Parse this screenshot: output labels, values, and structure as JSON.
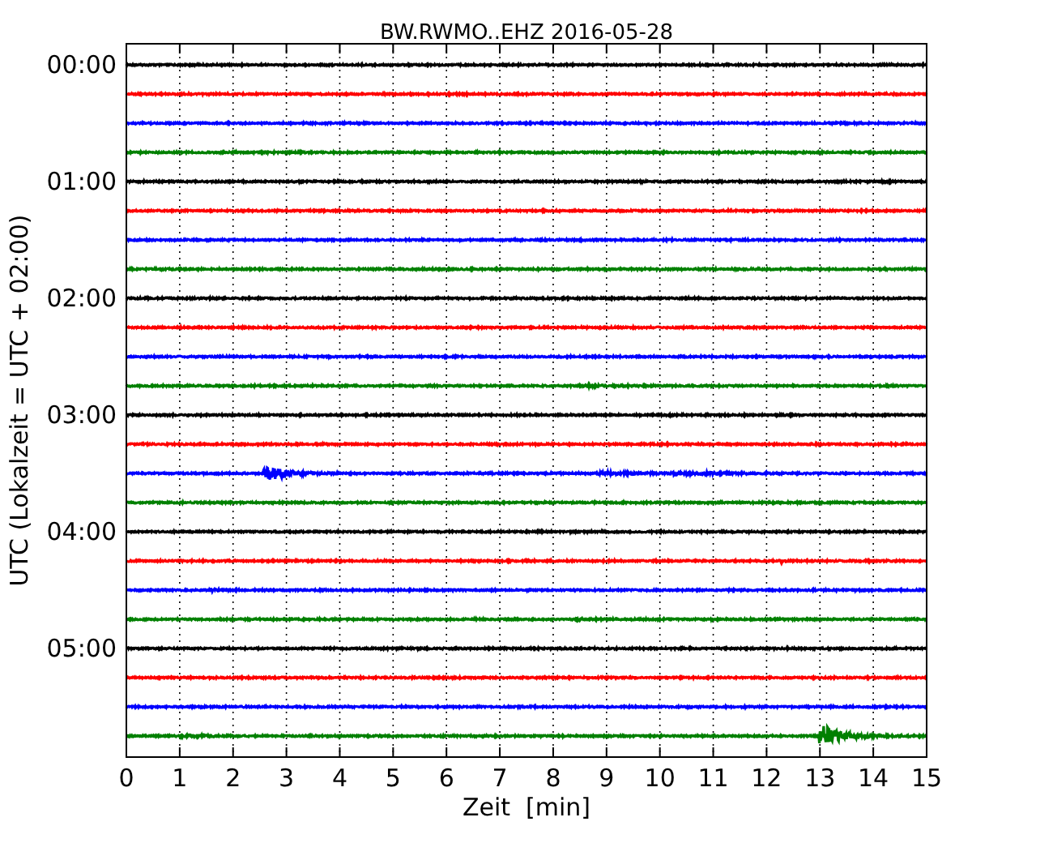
{
  "plot": {
    "title": "BW.RWMO..EHZ 2016-05-28",
    "x_axis": {
      "label": "Zeit  [min]",
      "ticks": [
        "0",
        "1",
        "2",
        "3",
        "4",
        "5",
        "6",
        "7",
        "8",
        "9",
        "10",
        "11",
        "12",
        "13",
        "14",
        "15"
      ]
    },
    "y_axis": {
      "label": "UTC (Lokalzeit = UTC + 02:00)",
      "ticks": [
        "00:00",
        "01:00",
        "02:00",
        "03:00",
        "04:00",
        "05:00"
      ]
    },
    "traces": [
      {
        "color": "#000000"
      },
      {
        "color": "#ff0000"
      },
      {
        "color": "#0000ff"
      },
      {
        "color": "#008000"
      },
      {
        "color": "#000000"
      },
      {
        "color": "#ff0000"
      },
      {
        "color": "#0000ff"
      },
      {
        "color": "#008000"
      },
      {
        "color": "#000000"
      },
      {
        "color": "#ff0000"
      },
      {
        "color": "#0000ff"
      },
      {
        "color": "#008000"
      },
      {
        "color": "#000000"
      },
      {
        "color": "#ff0000"
      },
      {
        "color": "#0000ff"
      },
      {
        "color": "#008000"
      },
      {
        "color": "#000000"
      },
      {
        "color": "#ff0000"
      },
      {
        "color": "#0000ff"
      },
      {
        "color": "#008000"
      },
      {
        "color": "#000000"
      },
      {
        "color": "#ff0000"
      },
      {
        "color": "#0000ff"
      },
      {
        "color": "#008000"
      }
    ]
  }
}
